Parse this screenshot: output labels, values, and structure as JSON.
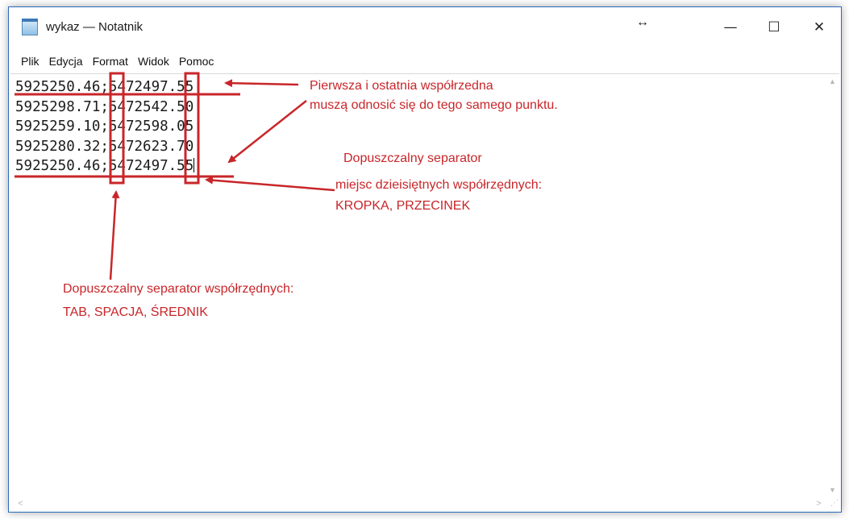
{
  "window": {
    "title": "wykaz — Notatnik",
    "resize_hint": "↔",
    "controls": {
      "minimize": "—",
      "maximize": "☐",
      "close": "✕"
    }
  },
  "menu": [
    "Plik",
    "Edycja",
    "Format",
    "Widok",
    "Pomoc"
  ],
  "editor": {
    "lines": [
      "5925250.46;5472497.55",
      "5925298.71;5472542.50",
      "5925259.10;5472598.05",
      "5925280.32;5472623.70",
      "5925250.46;5472497.55"
    ]
  },
  "annotations": {
    "first_last": {
      "line1": "Pierwsza i ostatnia współrzedna",
      "line2": "muszą odnosić się do tego samego punktu."
    },
    "decimal_separator": {
      "line1": "Dopuszczalny separator",
      "line2": "miejsc dzieisiętnych współrzędnych:",
      "line3": "KROPKA, PRZECINEK"
    },
    "coordinate_separator": {
      "line1": "Dopuszczalny separator współrzędnych:",
      "line2": "TAB, SPACJA, ŚREDNIK"
    },
    "color": "#c8262a"
  },
  "scrollbars": {
    "up": "▲",
    "down": "▼",
    "left": "<",
    "right": ">",
    "grip": "⋰"
  },
  "icons": [
    "notepad-icon",
    "resize-arrows-icon",
    "minimize-icon",
    "maximize-icon",
    "close-icon"
  ]
}
